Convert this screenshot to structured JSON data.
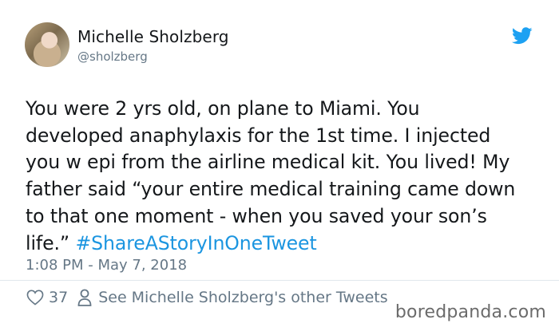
{
  "tweet": {
    "author": {
      "display_name": "Michelle Sholzberg",
      "handle": "@sholzberg"
    },
    "text_lines": [
      "You were 2 yrs old, on plane to Miami. You",
      "developed anaphylaxis for the 1st time. I injected",
      "you w epi from the airline medical kit. You lived! My",
      "father said “your entire medical training came down",
      "to that one moment - when you saved your son’s"
    ],
    "last_line_text": "life.” ",
    "hashtag": "#ShareAStoryInOneTweet",
    "timestamp": "1:08 PM - May 7, 2018",
    "like_count": "37",
    "other_tweets_label": "See Michelle Sholzberg's other Tweets"
  },
  "watermark": "boredpanda.com",
  "colors": {
    "text": "#14171a",
    "secondary": "#657786",
    "link": "#1b95e0",
    "brand": "#1da1f2"
  },
  "icons": {
    "brand": "twitter-bird-icon",
    "like": "heart-icon",
    "profile": "person-icon"
  }
}
